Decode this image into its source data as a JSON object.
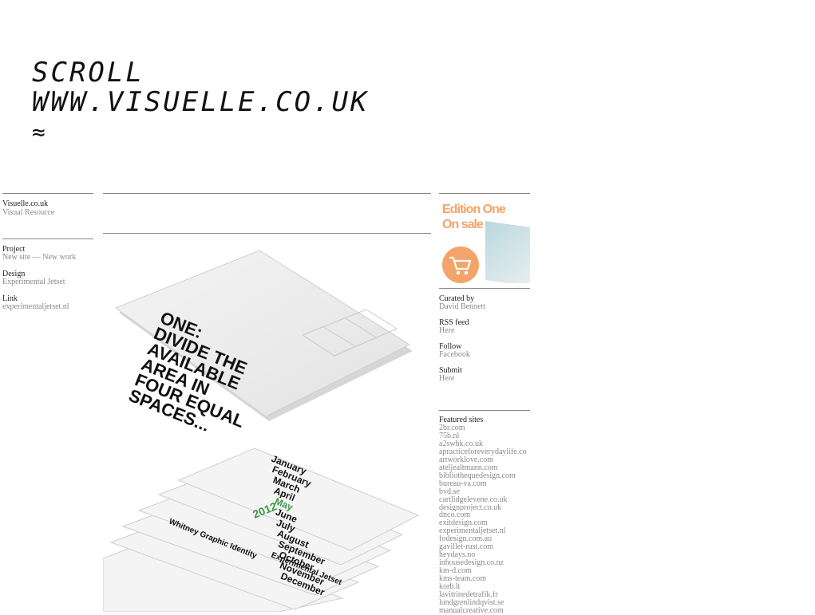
{
  "header": {
    "line1": "SCROLL",
    "line2": "WWW.VISUELLE.CO.UK",
    "line3": "≈"
  },
  "left": {
    "site_name": "Visuelle.co.uk",
    "site_sub": "Visual Resource",
    "meta": [
      {
        "key": "Project",
        "value": "New site — New work"
      },
      {
        "key": "Design",
        "value": "Experimental Jetset"
      },
      {
        "key": "Link",
        "value": "experimentaljetset.nl"
      }
    ]
  },
  "photos": [
    {
      "caption_lines": [
        "ONE:",
        "DIVIDE THE",
        "AVAILABLE",
        "AREA IN",
        "FOUR EQUAL",
        "SPACES..."
      ]
    },
    {
      "months": [
        "January",
        "February",
        "March",
        "April",
        "May",
        "June",
        "July",
        "August",
        "September",
        "October",
        "November",
        "December"
      ],
      "year": "2012",
      "label": "Whitney Graphic Identity",
      "footer": "Experimental Jetset"
    }
  ],
  "right": {
    "ad": {
      "line1": "Edition One",
      "line2": "On sale"
    },
    "meta": [
      {
        "key": "Curated by",
        "value": "David Bennett"
      },
      {
        "key": "RSS feed",
        "value": "Here"
      },
      {
        "key": "Follow",
        "value": "Facebook"
      },
      {
        "key": "Submit",
        "value": "Here"
      }
    ],
    "featured_heading": "Featured sites",
    "featured": [
      "2br.com",
      "75b.nl",
      "a2swhk.co.uk",
      "apracticeforeverydaylife.co",
      "artworklove.com",
      "ateljealtmann.com",
      "bibliothequedesign.com",
      "bureau-va.com",
      "bvd.se",
      "cartlidgelevene.co.uk",
      "designproject.co.uk",
      "dnco.com",
      "exitdesign.com",
      "experimentaljetset.nl",
      "fodesign.com.au",
      "gavillet-rust.com",
      "heydays.no",
      "inhousedesign.co.nz",
      "km-d.com",
      "kms-team.com",
      "korb.lt",
      "lavitrinedetrafik.fr",
      "lundgrenlindqvist.se",
      "manualcreative.com"
    ]
  },
  "colors": {
    "accent": "#f3a46a",
    "muted": "#888888"
  }
}
